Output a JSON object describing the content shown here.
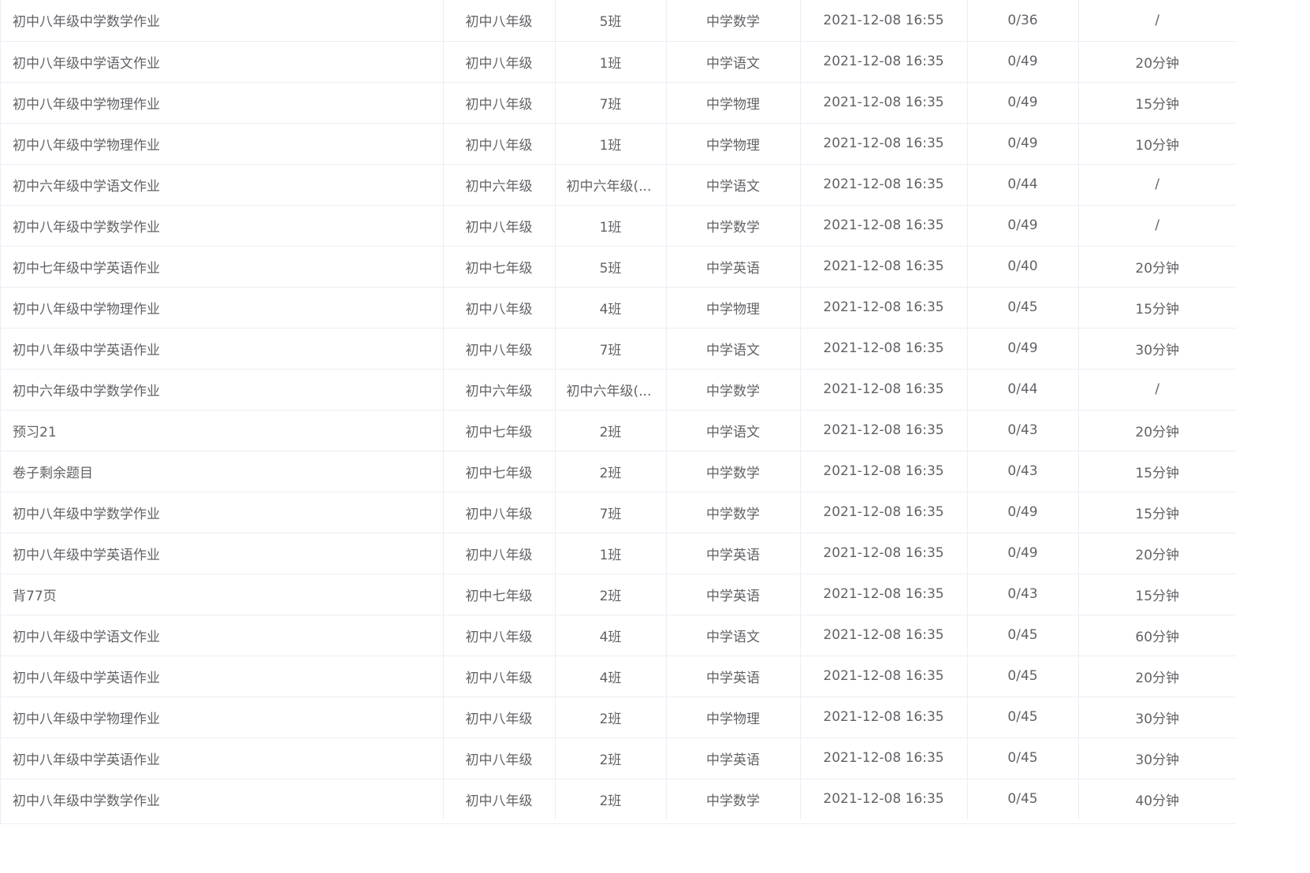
{
  "table": {
    "rows": [
      {
        "title": "初中八年级中学数学作业",
        "grade": "初中八年级",
        "class": "5班",
        "subject": "中学数学",
        "time": "2021-12-08 16:55",
        "progress": "0/36",
        "duration": "/"
      },
      {
        "title": "初中八年级中学语文作业",
        "grade": "初中八年级",
        "class": "1班",
        "subject": "中学语文",
        "time": "2021-12-08 16:35",
        "progress": "0/49",
        "duration": "20分钟"
      },
      {
        "title": "初中八年级中学物理作业",
        "grade": "初中八年级",
        "class": "7班",
        "subject": "中学物理",
        "time": "2021-12-08 16:35",
        "progress": "0/49",
        "duration": "15分钟"
      },
      {
        "title": "初中八年级中学物理作业",
        "grade": "初中八年级",
        "class": "1班",
        "subject": "中学物理",
        "time": "2021-12-08 16:35",
        "progress": "0/49",
        "duration": "10分钟"
      },
      {
        "title": "初中六年级中学语文作业",
        "grade": "初中六年级",
        "class": "初中六年级(...",
        "subject": "中学语文",
        "time": "2021-12-08 16:35",
        "progress": "0/44",
        "duration": "/"
      },
      {
        "title": "初中八年级中学数学作业",
        "grade": "初中八年级",
        "class": "1班",
        "subject": "中学数学",
        "time": "2021-12-08 16:35",
        "progress": "0/49",
        "duration": "/"
      },
      {
        "title": "初中七年级中学英语作业",
        "grade": "初中七年级",
        "class": "5班",
        "subject": "中学英语",
        "time": "2021-12-08 16:35",
        "progress": "0/40",
        "duration": "20分钟"
      },
      {
        "title": "初中八年级中学物理作业",
        "grade": "初中八年级",
        "class": "4班",
        "subject": "中学物理",
        "time": "2021-12-08 16:35",
        "progress": "0/45",
        "duration": "15分钟"
      },
      {
        "title": "初中八年级中学英语作业",
        "grade": "初中八年级",
        "class": "7班",
        "subject": "中学语文",
        "time": "2021-12-08 16:35",
        "progress": "0/49",
        "duration": "30分钟"
      },
      {
        "title": "初中六年级中学数学作业",
        "grade": "初中六年级",
        "class": "初中六年级(...",
        "subject": "中学数学",
        "time": "2021-12-08 16:35",
        "progress": "0/44",
        "duration": "/"
      },
      {
        "title": "预习21",
        "grade": "初中七年级",
        "class": "2班",
        "subject": "中学语文",
        "time": "2021-12-08 16:35",
        "progress": "0/43",
        "duration": "20分钟"
      },
      {
        "title": "卷子剩余题目",
        "grade": "初中七年级",
        "class": "2班",
        "subject": "中学数学",
        "time": "2021-12-08 16:35",
        "progress": "0/43",
        "duration": "15分钟"
      },
      {
        "title": "初中八年级中学数学作业",
        "grade": "初中八年级",
        "class": "7班",
        "subject": "中学数学",
        "time": "2021-12-08 16:35",
        "progress": "0/49",
        "duration": "15分钟"
      },
      {
        "title": "初中八年级中学英语作业",
        "grade": "初中八年级",
        "class": "1班",
        "subject": "中学英语",
        "time": "2021-12-08 16:35",
        "progress": "0/49",
        "duration": "20分钟"
      },
      {
        "title": "背77页",
        "grade": "初中七年级",
        "class": "2班",
        "subject": "中学英语",
        "time": "2021-12-08 16:35",
        "progress": "0/43",
        "duration": "15分钟"
      },
      {
        "title": "初中八年级中学语文作业",
        "grade": "初中八年级",
        "class": "4班",
        "subject": "中学语文",
        "time": "2021-12-08 16:35",
        "progress": "0/45",
        "duration": "60分钟"
      },
      {
        "title": "初中八年级中学英语作业",
        "grade": "初中八年级",
        "class": "4班",
        "subject": "中学英语",
        "time": "2021-12-08 16:35",
        "progress": "0/45",
        "duration": "20分钟"
      },
      {
        "title": "初中八年级中学物理作业",
        "grade": "初中八年级",
        "class": "2班",
        "subject": "中学物理",
        "time": "2021-12-08 16:35",
        "progress": "0/45",
        "duration": "30分钟"
      },
      {
        "title": "初中八年级中学英语作业",
        "grade": "初中八年级",
        "class": "2班",
        "subject": "中学英语",
        "time": "2021-12-08 16:35",
        "progress": "0/45",
        "duration": "30分钟"
      },
      {
        "title": "初中八年级中学数学作业",
        "grade": "初中八年级",
        "class": "2班",
        "subject": "中学数学",
        "time": "2021-12-08 16:35",
        "progress": "0/45",
        "duration": "40分钟"
      }
    ]
  }
}
